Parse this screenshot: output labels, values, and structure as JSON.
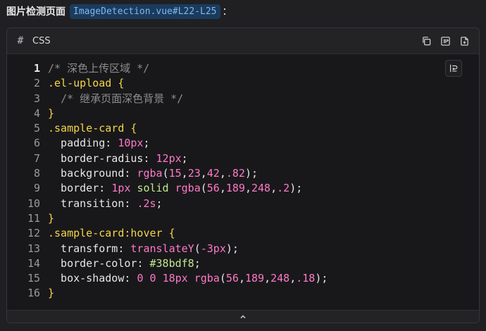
{
  "caption": {
    "title": "图片检测页面",
    "code_ref": "ImageDetection.vue#L22-L25",
    "colon": "："
  },
  "panel": {
    "lang_icon": "#",
    "lang_label": "CSS",
    "actions": [
      {
        "name": "copy-icon"
      },
      {
        "name": "insert-icon"
      },
      {
        "name": "new-file-icon"
      }
    ],
    "wrap_icon": "wrap-lines-icon",
    "collapse_icon": "chevron-up-icon"
  },
  "code": {
    "lines": [
      {
        "n": "1",
        "tokens": [
          {
            "c": "t-comment",
            "t": "/* 深色上传区域 */"
          }
        ]
      },
      {
        "n": "2",
        "tokens": [
          {
            "c": "t-sel",
            "t": ".el-upload"
          },
          {
            "c": "t-punc",
            "t": " "
          },
          {
            "c": "t-brace",
            "t": "{"
          }
        ]
      },
      {
        "n": "3",
        "tokens": [
          {
            "c": "t-punc",
            "t": "  "
          },
          {
            "c": "t-comment",
            "t": "/* 继承页面深色背景 */"
          }
        ]
      },
      {
        "n": "4",
        "tokens": [
          {
            "c": "t-brace",
            "t": "}"
          }
        ]
      },
      {
        "n": "5",
        "tokens": [
          {
            "c": "t-sel",
            "t": ".sample-card"
          },
          {
            "c": "t-punc",
            "t": " "
          },
          {
            "c": "t-brace",
            "t": "{"
          }
        ]
      },
      {
        "n": "6",
        "tokens": [
          {
            "c": "t-prop",
            "t": "  padding"
          },
          {
            "c": "t-punc",
            "t": ": "
          },
          {
            "c": "t-num",
            "t": "10px"
          },
          {
            "c": "t-punc",
            "t": ";"
          }
        ]
      },
      {
        "n": "7",
        "tokens": [
          {
            "c": "t-prop",
            "t": "  border-radius"
          },
          {
            "c": "t-punc",
            "t": ": "
          },
          {
            "c": "t-num",
            "t": "12px"
          },
          {
            "c": "t-punc",
            "t": ";"
          }
        ]
      },
      {
        "n": "8",
        "tokens": [
          {
            "c": "t-prop",
            "t": "  background"
          },
          {
            "c": "t-punc",
            "t": ": "
          },
          {
            "c": "t-fn",
            "t": "rgba"
          },
          {
            "c": "t-punc",
            "t": "("
          },
          {
            "c": "t-num",
            "t": "15"
          },
          {
            "c": "t-punc",
            "t": ","
          },
          {
            "c": "t-num",
            "t": "23"
          },
          {
            "c": "t-punc",
            "t": ","
          },
          {
            "c": "t-num",
            "t": "42"
          },
          {
            "c": "t-punc",
            "t": ","
          },
          {
            "c": "t-num",
            "t": ".82"
          },
          {
            "c": "t-punc",
            "t": ");"
          }
        ]
      },
      {
        "n": "9",
        "tokens": [
          {
            "c": "t-prop",
            "t": "  border"
          },
          {
            "c": "t-punc",
            "t": ": "
          },
          {
            "c": "t-num",
            "t": "1px"
          },
          {
            "c": "t-punc",
            "t": " "
          },
          {
            "c": "t-kw",
            "t": "solid"
          },
          {
            "c": "t-punc",
            "t": " "
          },
          {
            "c": "t-fn",
            "t": "rgba"
          },
          {
            "c": "t-punc",
            "t": "("
          },
          {
            "c": "t-num",
            "t": "56"
          },
          {
            "c": "t-punc",
            "t": ","
          },
          {
            "c": "t-num",
            "t": "189"
          },
          {
            "c": "t-punc",
            "t": ","
          },
          {
            "c": "t-num",
            "t": "248"
          },
          {
            "c": "t-punc",
            "t": ","
          },
          {
            "c": "t-num",
            "t": ".2"
          },
          {
            "c": "t-punc",
            "t": ");"
          }
        ]
      },
      {
        "n": "10",
        "tokens": [
          {
            "c": "t-prop",
            "t": "  transition"
          },
          {
            "c": "t-punc",
            "t": ": "
          },
          {
            "c": "t-num",
            "t": ".2s"
          },
          {
            "c": "t-punc",
            "t": ";"
          }
        ]
      },
      {
        "n": "11",
        "tokens": [
          {
            "c": "t-brace",
            "t": "}"
          }
        ]
      },
      {
        "n": "12",
        "tokens": [
          {
            "c": "t-sel",
            "t": ".sample-card:hover"
          },
          {
            "c": "t-punc",
            "t": " "
          },
          {
            "c": "t-brace",
            "t": "{"
          }
        ]
      },
      {
        "n": "13",
        "tokens": [
          {
            "c": "t-prop",
            "t": "  transform"
          },
          {
            "c": "t-punc",
            "t": ": "
          },
          {
            "c": "t-fn",
            "t": "translateY"
          },
          {
            "c": "t-punc",
            "t": "("
          },
          {
            "c": "t-num",
            "t": "-3px"
          },
          {
            "c": "t-punc",
            "t": ");"
          }
        ]
      },
      {
        "n": "14",
        "tokens": [
          {
            "c": "t-prop",
            "t": "  border-color"
          },
          {
            "c": "t-punc",
            "t": ": "
          },
          {
            "c": "t-str",
            "t": "#38bdf8"
          },
          {
            "c": "t-punc",
            "t": ";"
          }
        ]
      },
      {
        "n": "15",
        "tokens": [
          {
            "c": "t-prop",
            "t": "  box-shadow"
          },
          {
            "c": "t-punc",
            "t": ": "
          },
          {
            "c": "t-num",
            "t": "0"
          },
          {
            "c": "t-punc",
            "t": " "
          },
          {
            "c": "t-num",
            "t": "0"
          },
          {
            "c": "t-punc",
            "t": " "
          },
          {
            "c": "t-num",
            "t": "18px"
          },
          {
            "c": "t-punc",
            "t": " "
          },
          {
            "c": "t-fn",
            "t": "rgba"
          },
          {
            "c": "t-punc",
            "t": "("
          },
          {
            "c": "t-num",
            "t": "56"
          },
          {
            "c": "t-punc",
            "t": ","
          },
          {
            "c": "t-num",
            "t": "189"
          },
          {
            "c": "t-punc",
            "t": ","
          },
          {
            "c": "t-num",
            "t": "248"
          },
          {
            "c": "t-punc",
            "t": ","
          },
          {
            "c": "t-num",
            "t": ".18"
          },
          {
            "c": "t-punc",
            "t": ");"
          }
        ]
      },
      {
        "n": "16",
        "tokens": [
          {
            "c": "t-brace",
            "t": "}"
          }
        ]
      }
    ]
  },
  "colors": {
    "selector": "#f5d547",
    "number": "#ff79c6",
    "keyword": "#c3e88d",
    "comment": "#8c8c8c",
    "code_ref_bg": "#1b3b5c",
    "code_ref_text": "#7fb7ee"
  }
}
